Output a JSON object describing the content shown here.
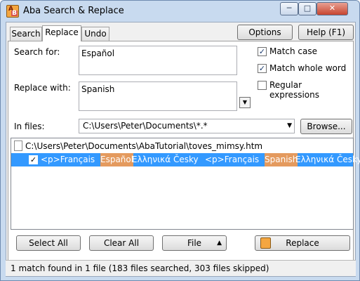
{
  "window": {
    "title": "Aba Search & Replace",
    "icon_letters": [
      "A",
      "B"
    ],
    "controls": [
      "─",
      "□",
      "✕"
    ]
  },
  "tabs": [
    {
      "label": "Search",
      "active": false
    },
    {
      "label": "Replace",
      "active": true
    },
    {
      "label": "Undo",
      "active": false
    }
  ],
  "toolbar": {
    "options_label": "Options",
    "help_label": "Help (F1)"
  },
  "form": {
    "search_label": "Search for:",
    "search_value": "Español",
    "replace_label": "Replace with:",
    "replace_value": "Spanish",
    "files_label": "In files:",
    "files_value": "C:\\Users\\Peter\\Documents\\*.*",
    "browse_label": "Browse..."
  },
  "options": {
    "match_case_label": "Match case",
    "match_case_checked": true,
    "whole_word_label": "Match whole word",
    "whole_word_checked": true,
    "regex_label": "Regular expressions",
    "regex_checked": false
  },
  "results": {
    "file_path": "C:\\Users\\Peter\\Documents\\AbaTutorial\\toves_mimsy.htm",
    "match": {
      "checked": true,
      "before_prefix": "<p>Français ",
      "before_match": "Español",
      "before_suffix": " Ελληνικά Česky",
      "after_prefix": "<p>Français ",
      "after_match": "Spanish",
      "after_suffix": " Ελληνικά Česky"
    }
  },
  "actions": {
    "select_all": "Select All",
    "clear_all": "Clear All",
    "file_label": "File",
    "file_arrow": "▲",
    "replace_label": "Replace"
  },
  "status": {
    "text": "1 match found in 1 file (183 files searched, 303 files skipped)"
  },
  "colors": {
    "selection": "#3399ff",
    "match_highlight": "#e49a5e",
    "frame": "#c8daef"
  }
}
